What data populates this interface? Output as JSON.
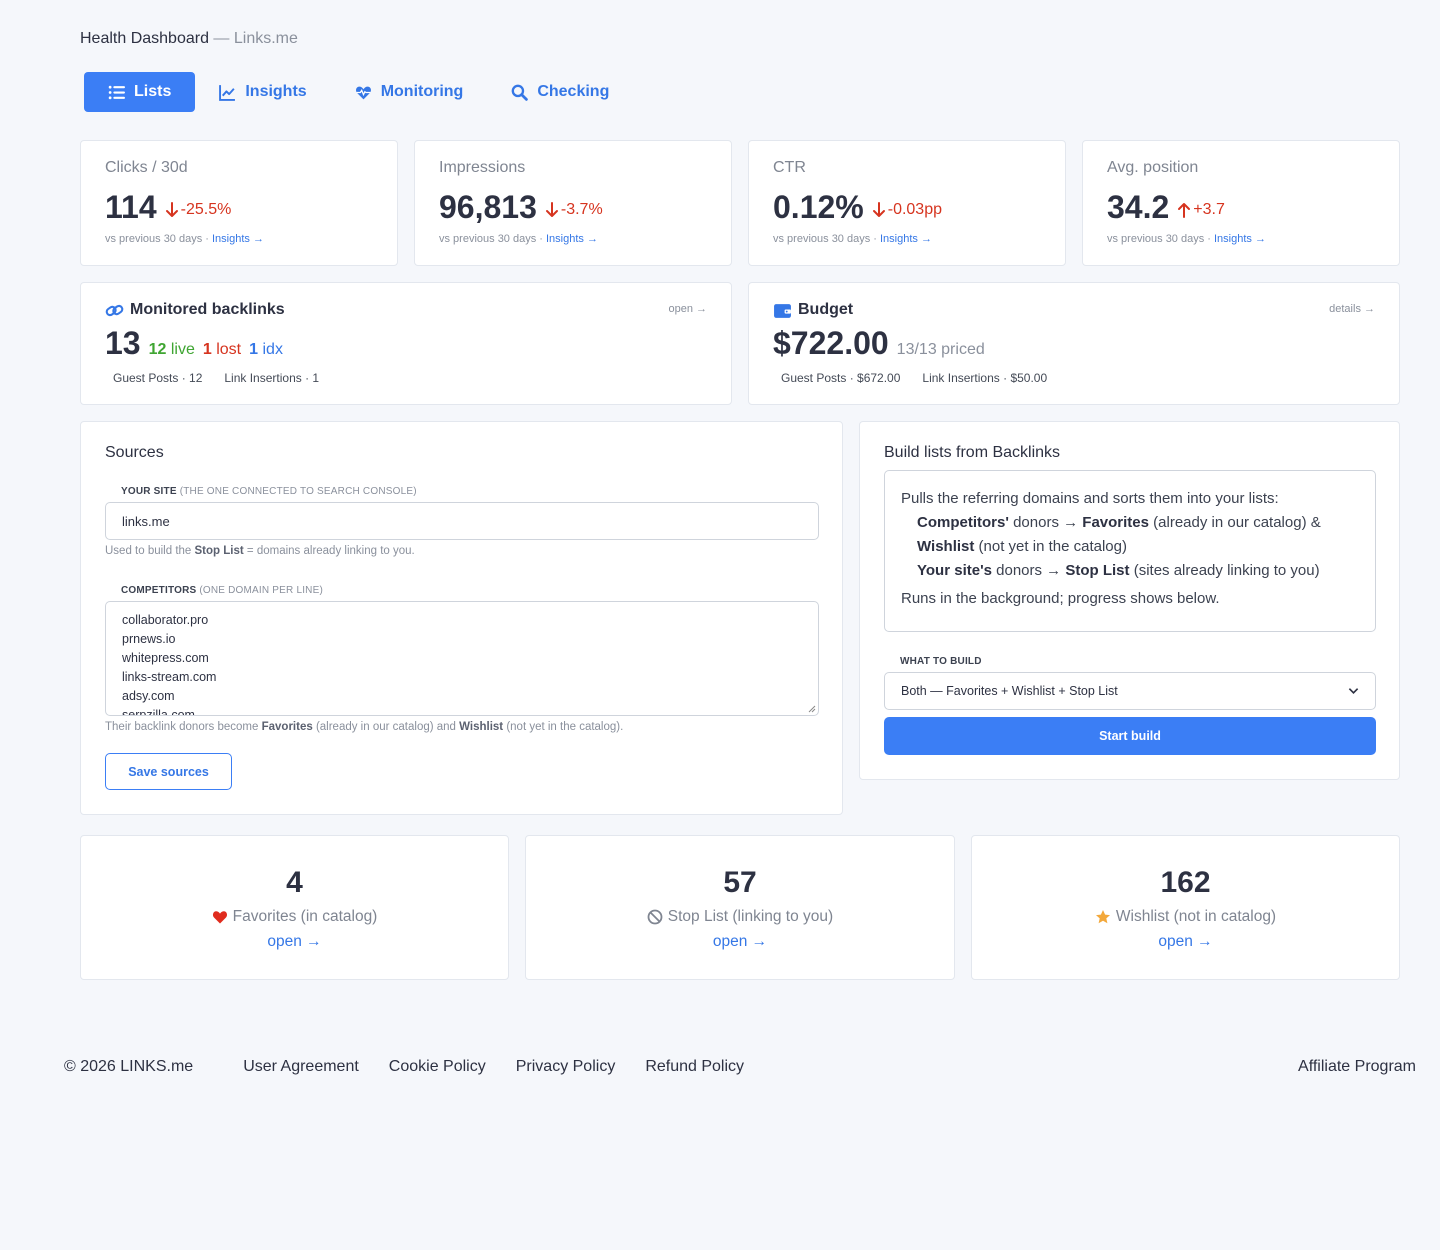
{
  "header": {
    "title": "Health Dashboard",
    "separator": " — ",
    "site": "Links.me"
  },
  "tabs": [
    {
      "label": "Lists",
      "icon": "list-icon",
      "active": true
    },
    {
      "label": "Insights",
      "icon": "line-chart-icon",
      "active": false
    },
    {
      "label": "Monitoring",
      "icon": "heartbeat-icon",
      "active": false
    },
    {
      "label": "Checking",
      "icon": "search-icon",
      "active": false
    }
  ],
  "metrics": [
    {
      "label": "Clicks / 30d",
      "value": "114",
      "delta": "-25.5%",
      "direction": "down",
      "sub": "vs previous 30 days · ",
      "link": "Insights →"
    },
    {
      "label": "Impressions",
      "value": "96,813",
      "delta": "-3.7%",
      "direction": "down",
      "sub": "vs previous 30 days · ",
      "link": "Insights →"
    },
    {
      "label": "CTR",
      "value": "0.12%",
      "delta": "-0.03pp",
      "direction": "down",
      "sub": "vs previous 30 days · ",
      "link": "Insights →"
    },
    {
      "label": "Avg. position",
      "value": "34.2",
      "delta": "+3.7",
      "direction": "up",
      "sub": "vs previous 30 days · ",
      "link": "Insights →"
    }
  ],
  "backlinks": {
    "title": "Monitored backlinks",
    "corner": "open →",
    "total": "13",
    "live_count": "12",
    "live_label": "live",
    "lost_count": "1",
    "lost_label": "lost",
    "idx_count": "1",
    "idx_label": "idx",
    "meta1": "Guest Posts · 12",
    "meta2": "Link Insertions · 1"
  },
  "budget": {
    "title": "Budget",
    "corner": "details →",
    "amount": "$722.00",
    "priced": "13/13 priced",
    "meta1": "Guest Posts · $672.00",
    "meta2": "Link Insertions · $50.00"
  },
  "sources": {
    "title": "Sources",
    "site_label": "Your site",
    "site_label_note": "(the one connected to Search Console)",
    "site_value": "links.me",
    "site_help_pre": "Used to build the ",
    "site_help_bold": "Stop List",
    "site_help_post": " = domains already linking to you.",
    "competitors_label": "Competitors",
    "competitors_label_note": "(one domain per line)",
    "competitors": [
      "collaborator.pro",
      "prnews.io",
      "whitepress.com",
      "links-stream.com",
      "adsy.com",
      "serpzilla.com"
    ],
    "comp_help_pre": "Their backlink donors become ",
    "comp_help_b1": "Favorites",
    "comp_help_mid": " (already in our catalog) and ",
    "comp_help_b2": "Wishlist",
    "comp_help_post": " (not yet in the catalog).",
    "save_button": "Save sources"
  },
  "build": {
    "title": "Build lists from Backlinks",
    "intro": "Pulls the referring domains and sorts them into your lists:",
    "l1_b1": "Competitors'",
    "l1_t1": " donors → ",
    "l1_b2": "Favorites",
    "l1_t2": " (already in our catalog) & ",
    "l1_b3": "Wishlist",
    "l1_t3": " (not yet in the catalog)",
    "l2_b1": "Your site's",
    "l2_t1": " donors → ",
    "l2_b2": "Stop List",
    "l2_t2": " (sites already linking to you)",
    "outro": "Runs in the background; progress shows below.",
    "what_label": "What to build",
    "select_value": "Both — Favorites + Wishlist + Stop List",
    "start_button": "Start build"
  },
  "stats": [
    {
      "value": "4",
      "label": "Favorites (in catalog)",
      "icon": "heart-icon",
      "link": "open →"
    },
    {
      "value": "57",
      "label": "Stop List (linking to you)",
      "icon": "ban-icon",
      "link": "open →"
    },
    {
      "value": "162",
      "label": "Wishlist (not in catalog)",
      "icon": "star-icon",
      "link": "open →"
    }
  ],
  "footer": {
    "copyright": "© 2026 LINKS.me",
    "links": [
      "User Agreement",
      "Cookie Policy",
      "Privacy Policy",
      "Refund Policy"
    ],
    "affiliate": "Affiliate Program"
  },
  "colors": {
    "accent": "#3b7ef5",
    "down": "#d6341f",
    "live": "#3fa532",
    "lost": "#d6341f",
    "idx": "#3577e6",
    "heart": "#e02c1e",
    "star": "#f3a83b"
  }
}
